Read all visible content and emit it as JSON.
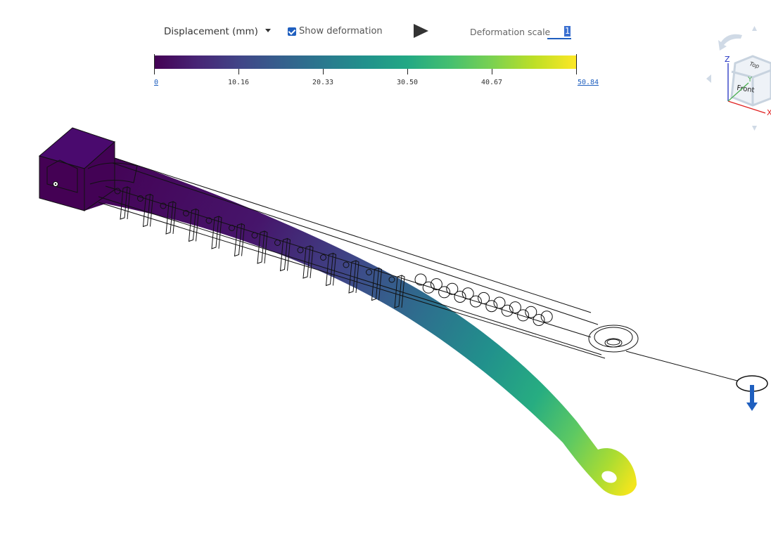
{
  "toolbar": {
    "result_type": "Displacement (mm)",
    "show_deformation_label": "Show deformation",
    "show_deformation_checked": true,
    "play_icon": "play-icon",
    "deformation_scale_label": "Deformation scale",
    "deformation_scale_value": "1"
  },
  "legend": {
    "units": "mm",
    "min": 0,
    "max": 50.84,
    "tick_labels": [
      "0",
      "10.16",
      "20.33",
      "30.50",
      "40.67",
      "50.84"
    ],
    "colormap": "viridis",
    "colors": [
      "#440154",
      "#482475",
      "#414487",
      "#355f8d",
      "#2a788e",
      "#21918c",
      "#22a884",
      "#44bf70",
      "#7ad151",
      "#bddf26",
      "#fde725"
    ]
  },
  "viewcube": {
    "faces": {
      "top": "Top",
      "front": "Front"
    },
    "axes": {
      "x": "X",
      "y": "Y",
      "z": "Z"
    },
    "axis_colors": {
      "x": "#e02020",
      "y": "#4caf50",
      "z": "#2030c0"
    }
  },
  "model": {
    "description": "deformed cantilever beam with undeformed wireframe overlay",
    "load_icon": "force-arrow-icon",
    "load_color": "#1f5fbf"
  }
}
